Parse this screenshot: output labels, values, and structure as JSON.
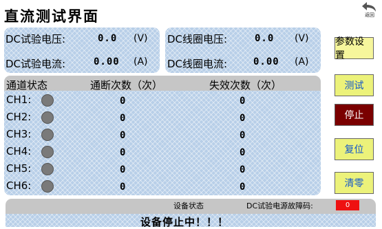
{
  "header": {
    "title": "直流测试界面",
    "back_label": "返回"
  },
  "dc_test": {
    "voltage_label": "DC试验电压:",
    "voltage_value": "0.0",
    "voltage_unit": "(V)",
    "current_label": "DC试验电流:",
    "current_value": "0.00",
    "current_unit": "(A)"
  },
  "coil": {
    "voltage_label": "DC线圈电压:",
    "voltage_value": "0.0",
    "voltage_unit": "(V)",
    "current_label": "DC线圈电流:",
    "current_value": "0.00",
    "current_unit": "(A)"
  },
  "channels": {
    "headers": {
      "status": "通道状态",
      "pass_count": "通断次数（次）",
      "fail_count": "失效次数（次）"
    },
    "rows": [
      {
        "label": "CH1:",
        "pass_count": "0",
        "fail_count": "0"
      },
      {
        "label": "CH2:",
        "pass_count": "0",
        "fail_count": "0"
      },
      {
        "label": "CH3:",
        "pass_count": "0",
        "fail_count": "0"
      },
      {
        "label": "CH4:",
        "pass_count": "0",
        "fail_count": "0"
      },
      {
        "label": "CH5:",
        "pass_count": "0",
        "fail_count": "0"
      },
      {
        "label": "CH6:",
        "pass_count": "0",
        "fail_count": "0"
      }
    ],
    "led_color": "#7a7a7a"
  },
  "buttons": {
    "params": "参数设置",
    "test": "测试",
    "stop": "停止",
    "reset": "复位",
    "clear": "清零"
  },
  "status": {
    "label": "设备状态",
    "fault_label": "DC试验电源故障码:",
    "fault_code": "0",
    "message": "设备停止中！！！"
  },
  "colors": {
    "panel": "#b8cfe8",
    "header_gray": "#c6c6c6",
    "stop_button": "#7a0000",
    "button_yellow": "#ecf27a",
    "fault_red": "#ee1111"
  }
}
